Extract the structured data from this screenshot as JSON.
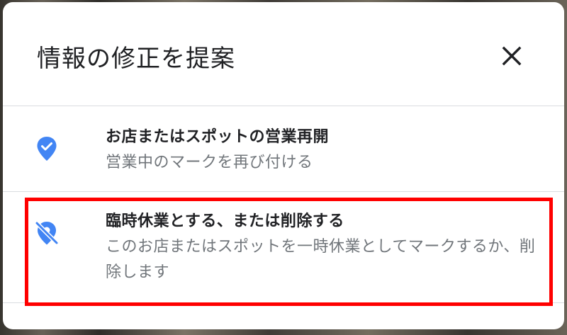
{
  "dialog": {
    "title": "情報の修正を提案",
    "close_icon": "close-icon"
  },
  "options": [
    {
      "icon": "verified-pin-icon",
      "title": "お店またはスポットの営業再開",
      "description": "営業中のマークを再び付ける"
    },
    {
      "icon": "pin-off-icon",
      "title": "臨時休業とする、または削除する",
      "description": "このお店またはスポットを一時休業としてマークするか、削除します"
    }
  ],
  "colors": {
    "accent_blue": "#4285f4",
    "highlight_red": "#ff0000",
    "title_text": "#202124",
    "secondary_text": "#70757a"
  }
}
